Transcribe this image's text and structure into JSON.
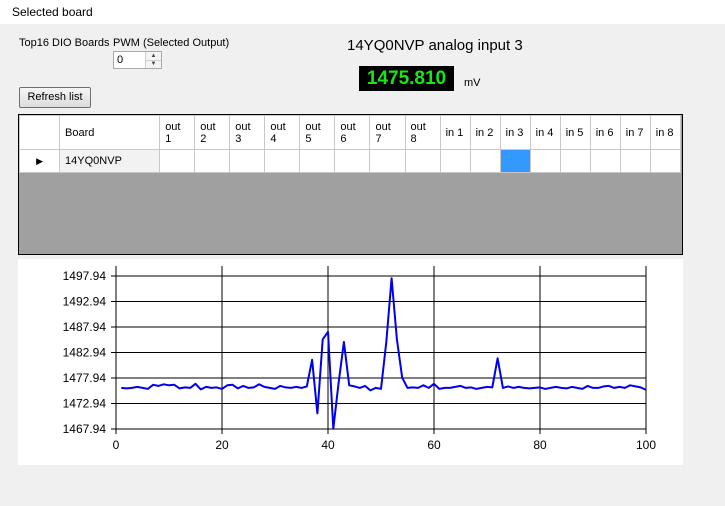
{
  "window": {
    "title": "Selected board"
  },
  "labels": {
    "boards_label": "Top16 DIO Boards",
    "pwm_label": "PWM (Selected Output)"
  },
  "pwm": {
    "value": "0"
  },
  "buttons": {
    "refresh": "Refresh list"
  },
  "reading": {
    "title": "14YQ0NVP analog input 3",
    "value": "1475.810",
    "unit": "mV",
    "value_color": "#19e619",
    "background_color": "#000000"
  },
  "table": {
    "columns": [
      "Board",
      "out\n1",
      "out\n2",
      "out\n3",
      "out\n4",
      "out\n5",
      "out\n6",
      "out\n7",
      "out\n8",
      "in 1",
      "in 2",
      "in 3",
      "in 4",
      "in 5",
      "in 6",
      "in 7",
      "in 8"
    ],
    "rows": [
      {
        "board": "14YQ0NVP",
        "selected_cell": "in 3"
      }
    ]
  },
  "chart_data": {
    "type": "line",
    "xlim": [
      0,
      100
    ],
    "ylim": [
      1467.94,
      1497.94
    ],
    "xticks": [
      "0",
      "20",
      "40",
      "60",
      "80",
      "100"
    ],
    "yticks": [
      "1497.94",
      "1492.94",
      "1487.94",
      "1482.94",
      "1477.94",
      "1472.94",
      "1467.94"
    ],
    "grid": true,
    "series": [
      {
        "color": "#0000ee",
        "x": [
          1,
          2,
          3,
          4,
          5,
          6,
          7,
          8,
          9,
          10,
          11,
          12,
          13,
          14,
          15,
          16,
          17,
          18,
          19,
          20,
          21,
          22,
          23,
          24,
          25,
          26,
          27,
          28,
          29,
          30,
          31,
          32,
          33,
          34,
          35,
          36,
          37,
          38,
          39,
          40,
          41,
          42,
          43,
          44,
          45,
          46,
          47,
          48,
          49,
          50,
          51,
          52,
          53,
          54,
          55,
          56,
          57,
          58,
          59,
          60,
          61,
          62,
          63,
          64,
          65,
          66,
          67,
          68,
          69,
          70,
          71,
          72,
          73,
          74,
          75,
          76,
          77,
          78,
          79,
          80,
          81,
          82,
          83,
          84,
          85,
          86,
          87,
          88,
          89,
          90,
          91,
          92,
          93,
          94,
          95,
          96,
          97,
          98,
          99,
          100
        ],
        "y": [
          1476.0,
          1475.9,
          1476.0,
          1476.2,
          1476.0,
          1475.8,
          1476.6,
          1476.4,
          1476.7,
          1476.5,
          1476.6,
          1475.9,
          1476.1,
          1476.0,
          1476.8,
          1475.7,
          1476.2,
          1476.0,
          1476.1,
          1475.8,
          1476.5,
          1476.6,
          1475.9,
          1476.4,
          1476.0,
          1476.1,
          1476.7,
          1476.2,
          1476.0,
          1475.8,
          1476.4,
          1476.1,
          1476.0,
          1476.2,
          1476.0,
          1476.3,
          1481.5,
          1471.0,
          1485.5,
          1487.0,
          1468.0,
          1477.0,
          1485.0,
          1476.5,
          1476.3,
          1476.0,
          1476.4,
          1475.5,
          1476.0,
          1475.8,
          1485.0,
          1497.5,
          1485.5,
          1478.0,
          1476.0,
          1476.1,
          1476.0,
          1476.5,
          1476.0,
          1476.8,
          1475.8,
          1476.0,
          1476.0,
          1476.2,
          1476.4,
          1476.0,
          1476.1,
          1475.8,
          1476.0,
          1476.2,
          1476.1,
          1481.8,
          1476.0,
          1476.3,
          1476.0,
          1476.2,
          1476.0,
          1475.9,
          1476.0,
          1476.1,
          1475.8,
          1476.0,
          1476.2,
          1476.0,
          1475.9,
          1476.2,
          1476.0,
          1475.8,
          1476.4,
          1476.0,
          1476.0,
          1476.3,
          1476.4,
          1476.0,
          1476.2,
          1476.0,
          1476.5,
          1476.3,
          1476.1,
          1475.6
        ]
      }
    ]
  }
}
